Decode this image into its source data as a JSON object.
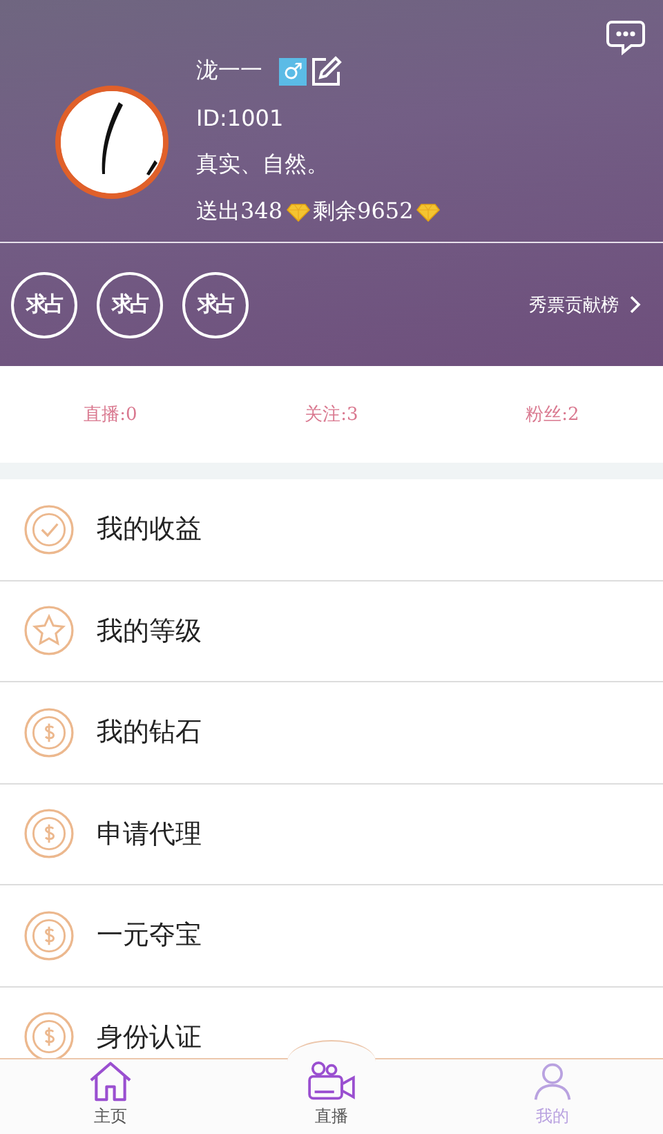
{
  "profile": {
    "name": "泷一一",
    "gender": "♂",
    "id": "ID:1001",
    "motto": "真实、自然。",
    "sent_label": "送出348",
    "remaining_label": "剩余9652"
  },
  "badges": [
    {
      "label": "求占"
    },
    {
      "label": "求占"
    },
    {
      "label": "求占"
    }
  ],
  "ranking_link": "秀票贡献榜",
  "stats": [
    "直播:0",
    "关注:3",
    "粉丝:2"
  ],
  "menu": [
    {
      "label": "我的收益",
      "kind": "check"
    },
    {
      "label": "我的等级",
      "kind": "star"
    },
    {
      "label": "我的钻石",
      "kind": "coin"
    },
    {
      "label": "申请代理",
      "kind": "coin"
    },
    {
      "label": "一元夺宝",
      "kind": "coin"
    },
    {
      "label": "身份认证",
      "kind": "coin"
    }
  ],
  "tabs": [
    {
      "label": "主页",
      "kind": "home",
      "selected": false
    },
    {
      "label": "直播",
      "kind": "camera",
      "selected": false
    },
    {
      "label": "我的",
      "kind": "person",
      "selected": true
    }
  ]
}
